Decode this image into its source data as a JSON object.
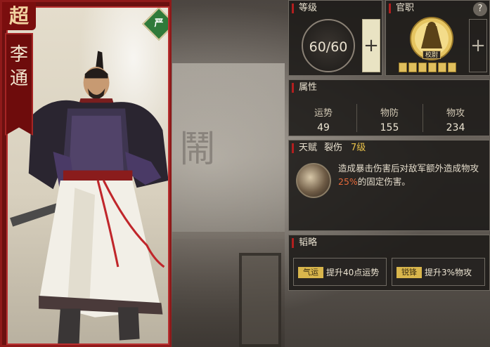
{
  "hero": {
    "rarity": "超",
    "name_line1": "李",
    "name_line2": "通",
    "faction": "严",
    "faction_color": "#2f7a3a"
  },
  "level": {
    "header": "等级",
    "value": "60/60",
    "plus_label": "+"
  },
  "office": {
    "header": "官职",
    "help_label": "?",
    "rank_title": "校尉",
    "rank_stars": 6,
    "plus_label": "+"
  },
  "attributes": {
    "header": "属性",
    "items": [
      {
        "label": "运势",
        "value": "49"
      },
      {
        "label": "物防",
        "value": "155"
      },
      {
        "label": "物攻",
        "value": "234"
      }
    ]
  },
  "talent": {
    "header": "天赋",
    "name": "裂伤",
    "level": "7级",
    "desc_part1": "造成暴击伤害后对敌军额外造成物攻",
    "desc_highlight": "25%",
    "desc_part2": "的固定伤害。",
    "highlight_color": "#e56a3a"
  },
  "tactics": {
    "header": "韬略",
    "items": [
      {
        "tag": "气运",
        "text": "提升40点运势"
      },
      {
        "tag": "锐锋",
        "text": "提升3%物攻"
      }
    ]
  },
  "background": {
    "glyph": "鬧"
  },
  "colors": {
    "card_frame": "#8f1a1a",
    "panel_bg": "#1c1a18",
    "accent_red": "#b21f1f",
    "gold": "#e0bf5d"
  }
}
